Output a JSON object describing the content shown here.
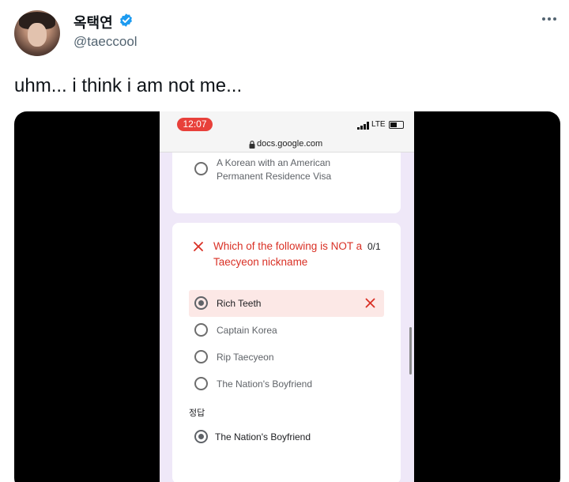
{
  "author": {
    "display_name": "옥택연",
    "handle": "@taeccool"
  },
  "tweet": {
    "text": "uhm... i think i am not me..."
  },
  "phone": {
    "time": "12:07",
    "network": "LTE",
    "url": "docs.google.com"
  },
  "form": {
    "previous_option": {
      "line1": "A Korean with an American",
      "line2": "Permanent Residence Visa"
    },
    "question": {
      "title_line1": "Which of the following is NOT a",
      "title_line2": "Taecyeon nickname",
      "score": "0/1",
      "options": [
        "Rich Teeth",
        "Captain Korea",
        "Rip Taecyeon",
        "The Nation's Boyfriend"
      ],
      "selected_index": 0,
      "correct_heading": "정답",
      "correct_answer": "The Nation's Boyfriend"
    }
  },
  "colors": {
    "verified": "#1d9bf0",
    "error": "#d93025",
    "time_pill": "#e8403a",
    "form_bg": "#efe8f8"
  },
  "icons": [
    "verified-icon",
    "more-icon",
    "signal-icon",
    "battery-icon",
    "lock-icon",
    "close-x-icon"
  ]
}
